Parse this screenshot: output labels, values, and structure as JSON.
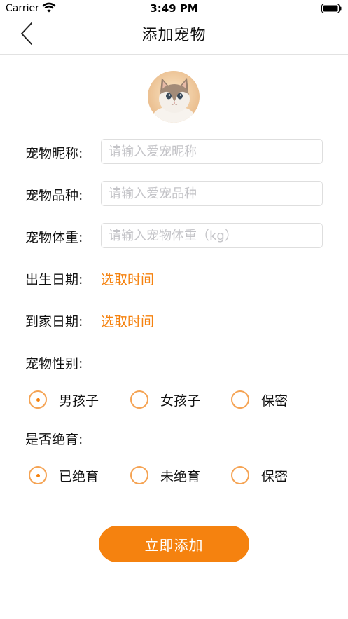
{
  "status_bar": {
    "carrier": "Carrier",
    "time": "3:49 PM"
  },
  "nav": {
    "title": "添加宠物"
  },
  "form": {
    "nickname": {
      "label": "宠物昵称:",
      "placeholder": "请输入爱宠昵称",
      "value": ""
    },
    "breed": {
      "label": "宠物品种:",
      "placeholder": "请输入爱宠品种",
      "value": ""
    },
    "weight": {
      "label": "宠物体重:",
      "placeholder": "请输入宠物体重（kg）",
      "value": ""
    },
    "birth_date": {
      "label": "出生日期:",
      "action": "选取时间"
    },
    "home_date": {
      "label": "到家日期:",
      "action": "选取时间"
    },
    "gender": {
      "label": "宠物性别:",
      "options": [
        "男孩子",
        "女孩子",
        "保密"
      ],
      "selected": "男孩子"
    },
    "neutered": {
      "label": "是否绝育:",
      "options": [
        "已绝育",
        "未绝育",
        "保密"
      ],
      "selected": "已绝育"
    }
  },
  "submit": {
    "label": "立即添加"
  },
  "colors": {
    "accent": "#f5820f",
    "radio_border": "#f5a353",
    "field_border": "#dedede",
    "placeholder": "#c4c4c8"
  }
}
